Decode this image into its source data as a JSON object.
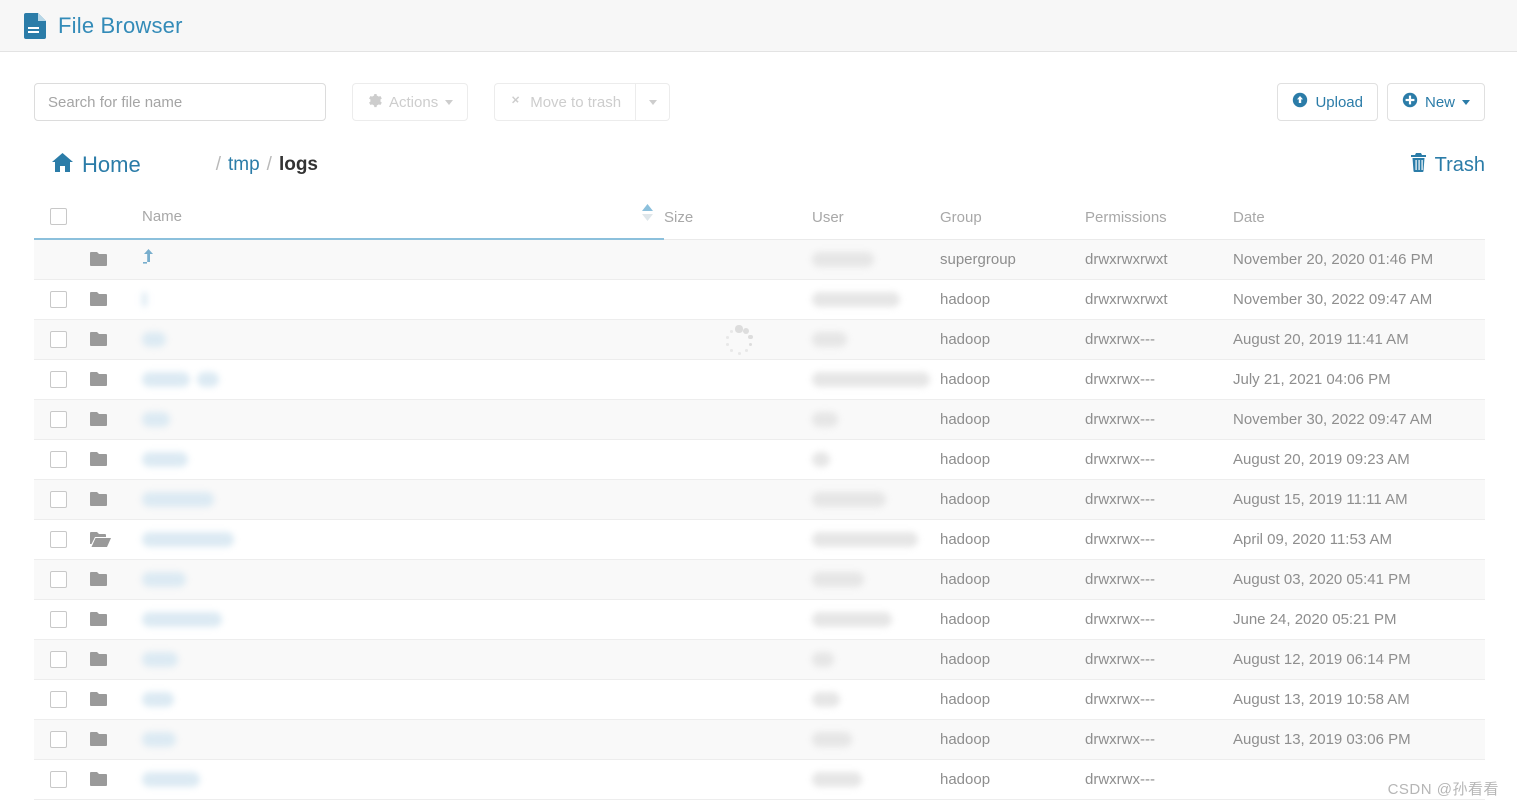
{
  "app": {
    "title": "File Browser",
    "doc_icon": "document-icon",
    "accent_color": "#2b7ca8",
    "appbar_bg": "#f7f7f7"
  },
  "toolbar": {
    "search_placeholder": "Search for file name",
    "search_value": "",
    "actions_label": "Actions",
    "actions_icon": "gear-icon",
    "move_to_trash_label": "Move to trash",
    "move_to_trash_icon": "x-mark-icon",
    "trash_dropdown_icon": "caret-down-icon",
    "upload_label": "Upload",
    "upload_icon": "upload-circle-icon",
    "new_label": "New",
    "new_icon": "plus-circle-icon",
    "new_caret_icon": "caret-down-icon"
  },
  "breadcrumb": {
    "home_label": "Home",
    "home_icon": "home-icon",
    "separator": "/",
    "segments": [
      {
        "label": "tmp",
        "current": false
      },
      {
        "label": "logs",
        "current": true
      }
    ],
    "trash_label": "Trash",
    "trash_icon": "trash-icon"
  },
  "table": {
    "columns": [
      {
        "key": "name",
        "label": "Name",
        "sorted": true,
        "sort_dir": "asc",
        "sort_icon": "sort-asc-icon"
      },
      {
        "key": "size",
        "label": "Size"
      },
      {
        "key": "user",
        "label": "User"
      },
      {
        "key": "group",
        "label": "Group"
      },
      {
        "key": "permissions",
        "label": "Permissions"
      },
      {
        "key": "date",
        "label": "Date"
      }
    ],
    "select_all_checked": false,
    "rows": [
      {
        "icon": "folder-icon",
        "name_redacted": true,
        "name_widths": [],
        "parent_link": true,
        "checkbox": false,
        "size": "",
        "user_redacted": true,
        "user_widths": [
          62
        ],
        "group": "supergroup",
        "permissions": "drwxrwxrwxt",
        "date": "November 20, 2020 01:46 PM"
      },
      {
        "icon": "folder-icon",
        "name_redacted": true,
        "name_widths": [
          5
        ],
        "parent_link": false,
        "checkbox": true,
        "size": "",
        "user_redacted": true,
        "user_widths": [
          88
        ],
        "group": "hadoop",
        "permissions": "drwxrwxrwxt",
        "date": "November 30, 2022 09:47 AM"
      },
      {
        "icon": "folder-icon",
        "name_redacted": true,
        "name_widths": [
          24
        ],
        "parent_link": false,
        "checkbox": true,
        "size": "",
        "user_redacted": true,
        "user_widths": [
          35
        ],
        "group": "hadoop",
        "permissions": "drwxrwx---",
        "date": "August 20, 2019 11:41 AM"
      },
      {
        "icon": "folder-icon",
        "name_redacted": true,
        "name_widths": [
          48,
          22
        ],
        "parent_link": false,
        "checkbox": true,
        "size": "",
        "user_redacted": true,
        "user_widths": [
          118
        ],
        "group": "hadoop",
        "permissions": "drwxrwx---",
        "date": "July 21, 2021 04:06 PM"
      },
      {
        "icon": "folder-icon",
        "name_redacted": true,
        "name_widths": [
          28
        ],
        "parent_link": false,
        "checkbox": true,
        "size": "",
        "user_redacted": true,
        "user_widths": [
          26
        ],
        "group": "hadoop",
        "permissions": "drwxrwx---",
        "date": "November 30, 2022 09:47 AM"
      },
      {
        "icon": "folder-icon",
        "name_redacted": true,
        "name_widths": [
          46
        ],
        "parent_link": false,
        "checkbox": true,
        "size": "",
        "user_redacted": true,
        "user_widths": [
          18
        ],
        "group": "hadoop",
        "permissions": "drwxrwx---",
        "date": "August 20, 2019 09:23 AM"
      },
      {
        "icon": "folder-icon",
        "name_redacted": true,
        "name_widths": [
          72
        ],
        "parent_link": false,
        "checkbox": true,
        "size": "",
        "user_redacted": true,
        "user_widths": [
          74
        ],
        "group": "hadoop",
        "permissions": "drwxrwx---",
        "date": "August 15, 2019 11:11 AM"
      },
      {
        "icon": "folder-open-icon",
        "name_redacted": true,
        "name_widths": [
          92
        ],
        "parent_link": false,
        "checkbox": true,
        "size": "",
        "user_redacted": true,
        "user_widths": [
          106
        ],
        "group": "hadoop",
        "permissions": "drwxrwx---",
        "date": "April 09, 2020 11:53 AM"
      },
      {
        "icon": "folder-icon",
        "name_redacted": true,
        "name_widths": [
          44
        ],
        "parent_link": false,
        "checkbox": true,
        "size": "",
        "user_redacted": true,
        "user_widths": [
          52
        ],
        "group": "hadoop",
        "permissions": "drwxrwx---",
        "date": "August 03, 2020 05:41 PM"
      },
      {
        "icon": "folder-icon",
        "name_redacted": true,
        "name_widths": [
          80
        ],
        "parent_link": false,
        "checkbox": true,
        "size": "",
        "user_redacted": true,
        "user_widths": [
          80
        ],
        "group": "hadoop",
        "permissions": "drwxrwx---",
        "date": "June 24, 2020 05:21 PM"
      },
      {
        "icon": "folder-icon",
        "name_redacted": true,
        "name_widths": [
          36
        ],
        "parent_link": false,
        "checkbox": true,
        "size": "",
        "user_redacted": true,
        "user_widths": [
          22
        ],
        "group": "hadoop",
        "permissions": "drwxrwx---",
        "date": "August 12, 2019 06:14 PM"
      },
      {
        "icon": "folder-icon",
        "name_redacted": true,
        "name_widths": [
          32
        ],
        "parent_link": false,
        "checkbox": true,
        "size": "",
        "user_redacted": true,
        "user_widths": [
          28
        ],
        "group": "hadoop",
        "permissions": "drwxrwx---",
        "date": "August 13, 2019 10:58 AM"
      },
      {
        "icon": "folder-icon",
        "name_redacted": true,
        "name_widths": [
          34
        ],
        "parent_link": false,
        "checkbox": true,
        "size": "",
        "user_redacted": true,
        "user_widths": [
          40
        ],
        "group": "hadoop",
        "permissions": "drwxrwx---",
        "date": "August 13, 2019 03:06 PM"
      },
      {
        "icon": "folder-icon",
        "name_redacted": true,
        "name_widths": [
          58
        ],
        "parent_link": false,
        "checkbox": true,
        "size": "",
        "user_redacted": true,
        "user_widths": [
          50
        ],
        "group": "hadoop",
        "permissions": "drwxrwx---",
        "date": ""
      }
    ]
  },
  "status": {
    "loading_spinner": "loading-spinner-icon"
  },
  "watermark": {
    "text": "CSDN @孙看看"
  }
}
